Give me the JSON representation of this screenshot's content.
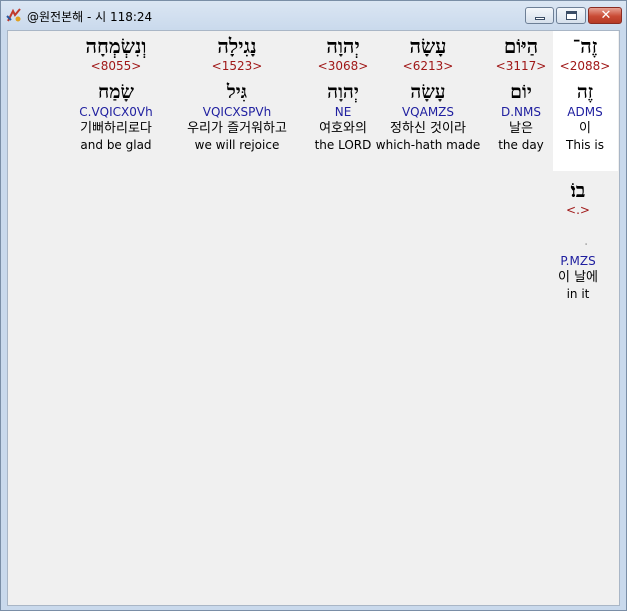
{
  "window": {
    "title": "@원전본해 - 시 118:24",
    "close_label": "✕"
  },
  "words": [
    {
      "hebrew": "זֶה־",
      "strong": "<2088>",
      "lemma": "זֶה",
      "parse": "ADMS",
      "korean": "이",
      "english": "This is"
    },
    {
      "hebrew": "הַיּוֹם",
      "strong": "<3117>",
      "lemma": "יוֹם",
      "parse": "D.NMS",
      "korean": "날은",
      "english": "the day"
    },
    {
      "hebrew": "עָשָׂה",
      "strong": "<6213>",
      "lemma": "עָשָׂה",
      "parse": "VQAMZS",
      "korean": "정하신 것이라",
      "english": "which-hath made"
    },
    {
      "hebrew": "יְהוָה",
      "strong": "<3068>",
      "lemma": "יְהוָה",
      "parse": "NE",
      "korean": "여호와의",
      "english": "the LORD"
    },
    {
      "hebrew": "נָגִילָה",
      "strong": "<1523>",
      "lemma": "גִּיל",
      "parse": "VQICXSPVh",
      "korean": "우리가 즐거워하고",
      "english": "we will rejoice"
    },
    {
      "hebrew": "וְנִשְׂמְחָה",
      "strong": "<8055>",
      "lemma": "שָׂמַח",
      "parse": "C.VQICX0Vh",
      "korean": "기뻐하리로다",
      "english": "and be glad"
    },
    {
      "hebrew": "בוֹ׃",
      "strong": "<.>",
      "lemma": "",
      "punct": "ׁ",
      "parse": "P.MZS",
      "korean": "이 날에",
      "english": "in it"
    }
  ]
}
